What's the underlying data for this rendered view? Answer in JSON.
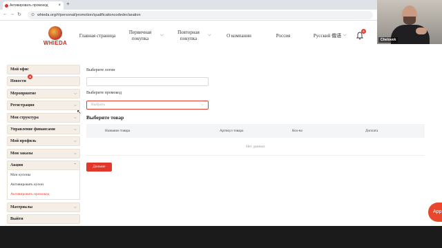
{
  "browser": {
    "tab_title": "Активировать промокод",
    "tab_close": "×",
    "new_tab": "+",
    "url": "whieda.org/#/personal/promotion/qualificationcodedeclaration"
  },
  "header": {
    "logo_text": "WHIEDA",
    "nav": [
      {
        "label": "Главная страница"
      },
      {
        "label": "Первичная покупка"
      },
      {
        "label": "Повторная покупка"
      },
      {
        "label": "О компании"
      },
      {
        "label": "Россия"
      },
      {
        "label": "Русский 俄语"
      }
    ],
    "notification_count": "6"
  },
  "webcam": {
    "name": "Chelovek"
  },
  "sidebar": {
    "items": [
      {
        "label": "Мой офис"
      },
      {
        "label": "Новости",
        "badge": "4"
      },
      {
        "label": "Мероприятие"
      },
      {
        "label": "Регистрация"
      },
      {
        "label": "Моя структура"
      },
      {
        "label": "Управление финансами"
      },
      {
        "label": "Мой профиль"
      },
      {
        "label": "Мои заказы"
      },
      {
        "label": "Акции"
      }
    ],
    "sub_items": [
      {
        "label": "Мои купоны"
      },
      {
        "label": "Активировать купон"
      },
      {
        "label": "Активировать промокод"
      }
    ],
    "bottom_items": [
      {
        "label": "Материалы"
      },
      {
        "label": "Выйти"
      }
    ]
  },
  "main": {
    "login_label": "Выберите логин",
    "login_value": "",
    "promo_label": "Выберите промокод",
    "promo_placeholder": "Выбрать",
    "product_title": "Выберите товар",
    "columns": [
      "Название товара",
      "Артикул товара",
      "Кол-во",
      "Доплата"
    ],
    "empty_text": "Нет данных",
    "next_button": "Дальше"
  },
  "float_button": "App",
  "colors": {
    "accent": "#e2382b",
    "sidebar_bg": "#f5eee6",
    "brand": "#b8322a"
  }
}
